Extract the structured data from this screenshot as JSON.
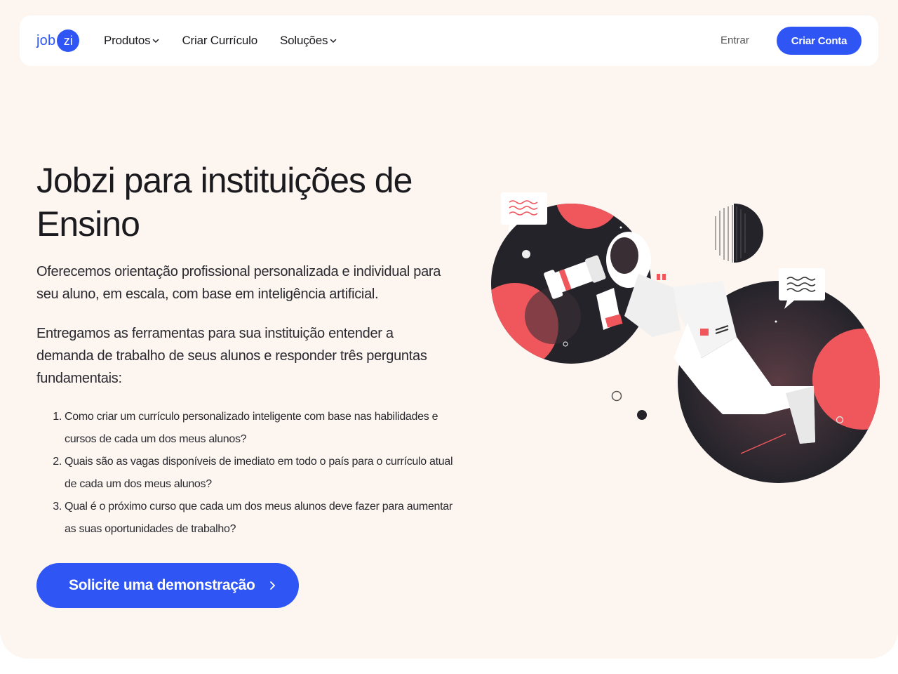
{
  "header": {
    "logo_text": "job",
    "logo_badge": "zi",
    "nav": [
      {
        "label": "Produtos",
        "dropdown": true
      },
      {
        "label": "Criar Currículo",
        "dropdown": false
      },
      {
        "label": "Soluções",
        "dropdown": true
      }
    ],
    "login_label": "Entrar",
    "signup_label": "Criar Conta"
  },
  "hero": {
    "title_line1": "Jobzi para instituições de",
    "title_line2": "Ensino",
    "paragraph1": "Oferecemos orientação profissional personalizada e individual para seu aluno, em escala, com base em inteligência artificial.",
    "paragraph2": "Entregamos as ferramentas para sua instituição entender a demanda de trabalho de seus alunos e responder três perguntas fundamentais:",
    "questions": [
      {
        "num": "1.",
        "text": "Como criar um currículo personalizado inteligente com base nas habilidades e cursos de cada um dos meus alunos?"
      },
      {
        "num": "2.",
        "text": "Quais são as vagas disponíveis de imediato em todo o país para o currículo atual de cada um dos meus alunos?"
      },
      {
        "num": "3.",
        "text": "Qual é o próximo curso que cada um dos meus alunos deve fazer para aumentar as suas oportunidades de trabalho?"
      }
    ],
    "cta_label": "Solicite uma demonstração"
  },
  "icons": {
    "chevron": "chevron-down-icon",
    "cta_arrow": "chevron-right-icon",
    "illustration": "astronaut-telescope-illustration"
  },
  "colors": {
    "brand_blue": "#2f56f5",
    "background": "#fcf5f0",
    "accent_red": "#f0575d",
    "dark": "#24232a"
  }
}
